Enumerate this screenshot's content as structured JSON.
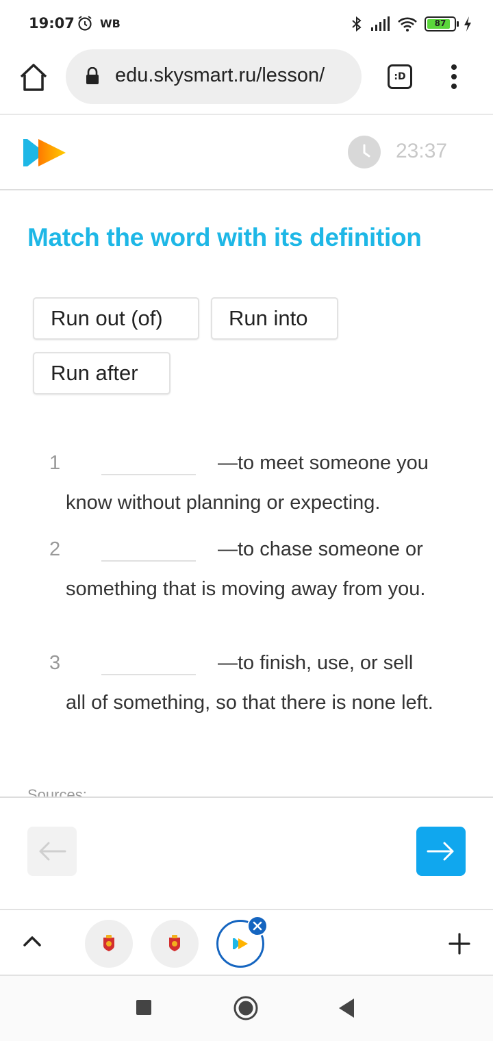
{
  "status_bar": {
    "time": "19:07",
    "carrier_badge": "WB",
    "battery_level": "87",
    "icons": [
      "alarm-icon",
      "bluetooth-icon",
      "signal-icon",
      "wifi-icon",
      "battery-icon",
      "charging-icon"
    ]
  },
  "browser": {
    "url": "edu.skysmart.ru/lesson/",
    "tab_switcher_label": ":D",
    "icons": [
      "home-icon",
      "lock-icon",
      "menu-dots-icon"
    ]
  },
  "app_header": {
    "timer": "23:37",
    "colors": {
      "logo_blue": "#1eb7e6",
      "logo_yellow": "#ffc400"
    }
  },
  "task": {
    "title": "Match the word with its definition",
    "title_color": "#1eb7e6",
    "options": [
      "Run out (of)",
      "Run into",
      "Run after"
    ],
    "items": [
      {
        "number": "1",
        "line1": "—to meet someone you",
        "rest": "know without planning or expecting."
      },
      {
        "number": "2",
        "line1": "—to chase someone or",
        "rest": "something that is moving away from you."
      },
      {
        "number": "3",
        "line1": "—to finish, use, or sell",
        "rest": "all of something, so that there is none left."
      }
    ],
    "sources_label": "Sources:"
  },
  "nav": {
    "next_color": "#10a7ee"
  }
}
